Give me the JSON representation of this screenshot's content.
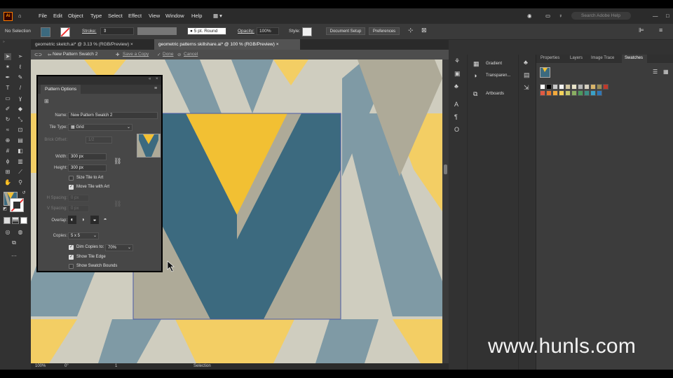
{
  "app": {
    "logo": "Ai"
  },
  "menu": [
    "File",
    "Edit",
    "Object",
    "Type",
    "Select",
    "Effect",
    "View",
    "Window",
    "Help"
  ],
  "search_placeholder": "Search Adobe Help",
  "control": {
    "selection": "No Selection",
    "stroke_label": "Stroke:",
    "stroke_profile": "5 pt. Round",
    "opacity_label": "Opacity:",
    "opacity_value": "100%",
    "style_label": "Style:",
    "doc_setup": "Document Setup",
    "preferences": "Preferences"
  },
  "tabs": [
    {
      "label": "geometric sketch.ai* @ 3.13 % (RGB/Preview)",
      "close": "×"
    },
    {
      "label": "geometric patterns skillshare.ai* @ 100 % (RGB/Preview)",
      "close": "×"
    }
  ],
  "isolation": {
    "name": "New Pattern Swatch 2",
    "save": "Save a Copy",
    "done": "Done",
    "cancel": "Cancel"
  },
  "pattern_options": {
    "title": "Pattern Options",
    "name_label": "Name:",
    "name_value": "New Pattern Swatch 2",
    "tile_type_label": "Tile Type:",
    "tile_type_value": "Grid",
    "brick_offset_label": "Brick Offset:",
    "brick_offset_value": "1/2",
    "width_label": "Width:",
    "width_value": "300 px",
    "height_label": "Height:",
    "height_value": "300 px",
    "size_tile": "Size Tile to Art",
    "move_tile": "Move Tile with Art",
    "hspacing_label": "H Spacing:",
    "hspacing_value": "0 px",
    "vspacing_label": "V Spacing:",
    "vspacing_value": "0 px",
    "overlap_label": "Overlap:",
    "copies_label": "Copies:",
    "copies_value": "5 x 5",
    "dim_copies": "Dim Copies to:",
    "dim_value": "70%",
    "show_tile_edge": "Show Tile Edge",
    "show_swatch_bounds": "Show Swatch Bounds",
    "checks": {
      "size_tile": false,
      "move_tile": true,
      "dim_copies": true,
      "show_tile_edge": true,
      "show_swatch_bounds": false
    }
  },
  "dock": {
    "gradient": "Gradient",
    "transparency": "Transparen...",
    "artboards": "Artboards"
  },
  "swatches_tabs": [
    "Properties",
    "Layers",
    "Image Trace",
    "Swatches"
  ],
  "swatch_colors": [
    "#ffffff",
    "#000000",
    "#c9c9c9",
    "#f2f2f2",
    "#d2c6a0",
    "#e8e3c9",
    "#b6b6b6",
    "#d6d0c0",
    "#d9b56a",
    "#9c8e57",
    "#c0392b",
    "#e05a43",
    "#e6772e",
    "#f2a93b",
    "#f5d25a",
    "#c6c76c",
    "#8aae62",
    "#4c9a5c",
    "#3b8f84",
    "#3aa0c7",
    "#2e77b8"
  ],
  "status": {
    "zoom": "100%",
    "rotation": "0°",
    "artboard": "1",
    "mode": "Selection"
  },
  "watermark": "www.hunls.com",
  "colors": {
    "yellow": "#f2c033",
    "teal": "#3c6a7f",
    "slate": "#7f9aa5",
    "beige": "#aeaa98",
    "cream": "#cfcdbf",
    "gold": "#f3ce64"
  }
}
